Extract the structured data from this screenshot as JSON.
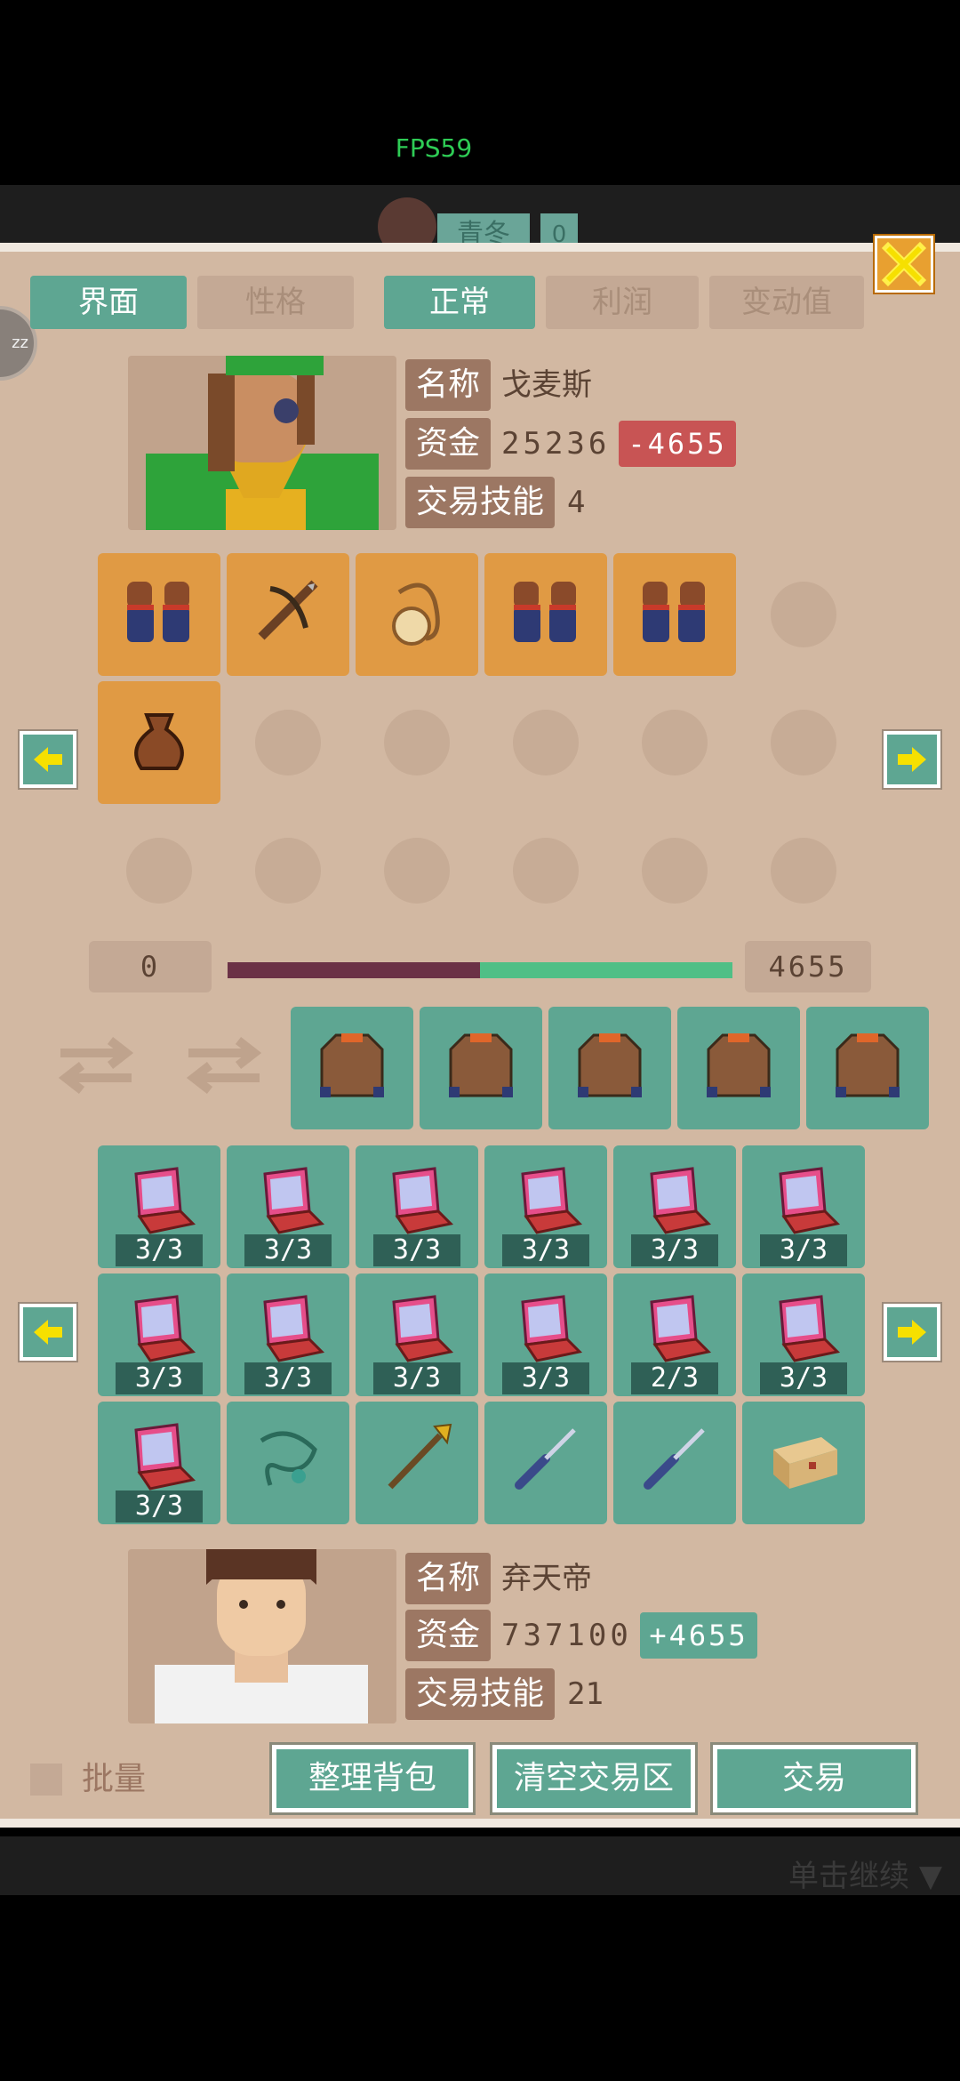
{
  "hud": {
    "fps": "FPS59",
    "name_partial": "青冬",
    "num_partial": "0"
  },
  "tabs": {
    "left": [
      {
        "label": "界面",
        "active": true
      },
      {
        "label": "性格",
        "active": false
      }
    ],
    "right": [
      {
        "label": "正常",
        "active": true
      },
      {
        "label": "利润",
        "active": false
      },
      {
        "label": "变动值",
        "active": false
      }
    ]
  },
  "side_button": "zz",
  "merchant": {
    "name_label": "名称",
    "name": "戈麦斯",
    "funds_label": "资金",
    "funds": "25236",
    "funds_delta": "-4655",
    "skill_label": "交易技能",
    "skill": "4"
  },
  "merchant_inventory": [
    {
      "icon": "gloves-icon"
    },
    {
      "icon": "crossbow-icon"
    },
    {
      "icon": "rope-bag-icon"
    },
    {
      "icon": "gloves-icon"
    },
    {
      "icon": "gloves-icon"
    },
    {
      "icon": ""
    },
    {
      "icon": "pouch-icon"
    },
    {
      "icon": ""
    },
    {
      "icon": ""
    },
    {
      "icon": ""
    },
    {
      "icon": ""
    },
    {
      "icon": ""
    },
    {
      "icon": ""
    },
    {
      "icon": ""
    },
    {
      "icon": ""
    },
    {
      "icon": ""
    },
    {
      "icon": ""
    },
    {
      "icon": ""
    }
  ],
  "balance": {
    "left": "0",
    "right": "4655",
    "fraction": 0.5
  },
  "trade_zone": [
    {
      "icon": "jacket-icon"
    },
    {
      "icon": "jacket-icon"
    },
    {
      "icon": "jacket-icon"
    },
    {
      "icon": "jacket-icon"
    },
    {
      "icon": "jacket-icon"
    }
  ],
  "player_inventory": [
    {
      "icon": "laptop-icon",
      "count": "3/3"
    },
    {
      "icon": "laptop-icon",
      "count": "3/3"
    },
    {
      "icon": "laptop-icon",
      "count": "3/3"
    },
    {
      "icon": "laptop-icon",
      "count": "3/3"
    },
    {
      "icon": "laptop-icon",
      "count": "3/3"
    },
    {
      "icon": "laptop-icon",
      "count": "3/3"
    },
    {
      "icon": "laptop-icon",
      "count": "3/3"
    },
    {
      "icon": "laptop-icon",
      "count": "3/3"
    },
    {
      "icon": "laptop-icon",
      "count": "3/3"
    },
    {
      "icon": "laptop-icon",
      "count": "3/3"
    },
    {
      "icon": "laptop-icon",
      "count": "2/3"
    },
    {
      "icon": "laptop-icon",
      "count": "3/3"
    },
    {
      "icon": "laptop-icon",
      "count": "3/3"
    },
    {
      "icon": "necklace-icon",
      "count": ""
    },
    {
      "icon": "spear-icon",
      "count": ""
    },
    {
      "icon": "screwdriver-icon",
      "count": ""
    },
    {
      "icon": "screwdriver-icon",
      "count": ""
    },
    {
      "icon": "box-icon",
      "count": ""
    }
  ],
  "player": {
    "name_label": "名称",
    "name": "弃天帝",
    "funds_label": "资金",
    "funds": "737100",
    "funds_delta": "+4655",
    "skill_label": "交易技能",
    "skill": "21"
  },
  "bottom": {
    "batch_label": "批量",
    "sort_button": "整理背包",
    "clear_button": "清空交易区",
    "trade_button": "交易"
  },
  "footer": {
    "continue": "单击继续"
  },
  "colors": {
    "teal": "#5ea692",
    "orange": "#e09a44",
    "panel": "#d2b8a2",
    "neg": "#c85454",
    "bar_left": "#6b3146",
    "bar_right": "#4fbf86"
  }
}
